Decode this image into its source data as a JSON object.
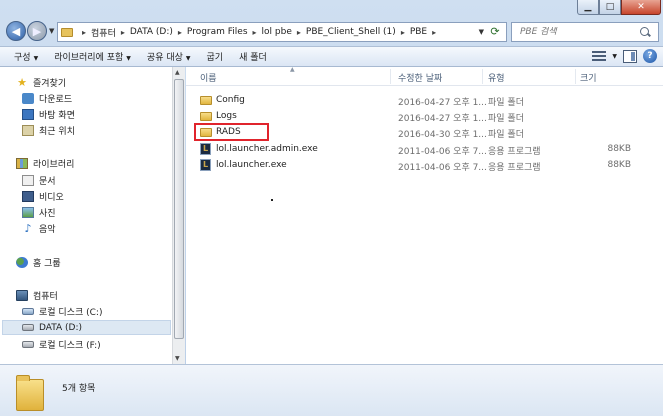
{
  "address": {
    "crumbs": [
      "컴퓨터",
      "DATA (D:)",
      "Program Files",
      "lol pbe",
      "PBE_Client_Shell (1)",
      "PBE"
    ]
  },
  "search": {
    "placeholder": "PBE 검색"
  },
  "toolbar": {
    "organize": "구성",
    "include_library": "라이브러리에 포함",
    "share": "공유 대상",
    "burn": "굽기",
    "new_folder": "새 폴더"
  },
  "nav": {
    "favorites": "즐겨찾기",
    "downloads": "다운로드",
    "desktop": "바탕 화면",
    "recent": "최근 위치",
    "libraries": "라이브러리",
    "documents": "문서",
    "videos": "비디오",
    "pictures": "사진",
    "music": "음악",
    "homegroup": "홈 그룹",
    "computer": "컴퓨터",
    "local_c": "로컬 디스크 (C:)",
    "data_d": "DATA (D:)",
    "local_f": "로컬 디스크 (F:)"
  },
  "columns": {
    "name": "이름",
    "date": "수정한 날짜",
    "type": "유형",
    "size": "크기"
  },
  "files": [
    {
      "name": "Config",
      "date": "2016-04-27 오후 1...",
      "type": "파일 폴더",
      "size": "",
      "kind": "folder"
    },
    {
      "name": "Logs",
      "date": "2016-04-27 오후 1...",
      "type": "파일 폴더",
      "size": "",
      "kind": "folder"
    },
    {
      "name": "RADS",
      "date": "2016-04-30 오후 1...",
      "type": "파일 폴더",
      "size": "",
      "kind": "folder"
    },
    {
      "name": "lol.launcher.admin.exe",
      "date": "2011-04-06 오후 7...",
      "type": "응용 프로그램",
      "size": "88KB",
      "kind": "exe"
    },
    {
      "name": "lol.launcher.exe",
      "date": "2011-04-06 오후 7...",
      "type": "응용 프로그램",
      "size": "88KB",
      "kind": "exe"
    }
  ],
  "status": {
    "item_count": "5개 항목"
  },
  "colors": {
    "highlight": "#e0242c",
    "selection": "#dde8f3"
  }
}
